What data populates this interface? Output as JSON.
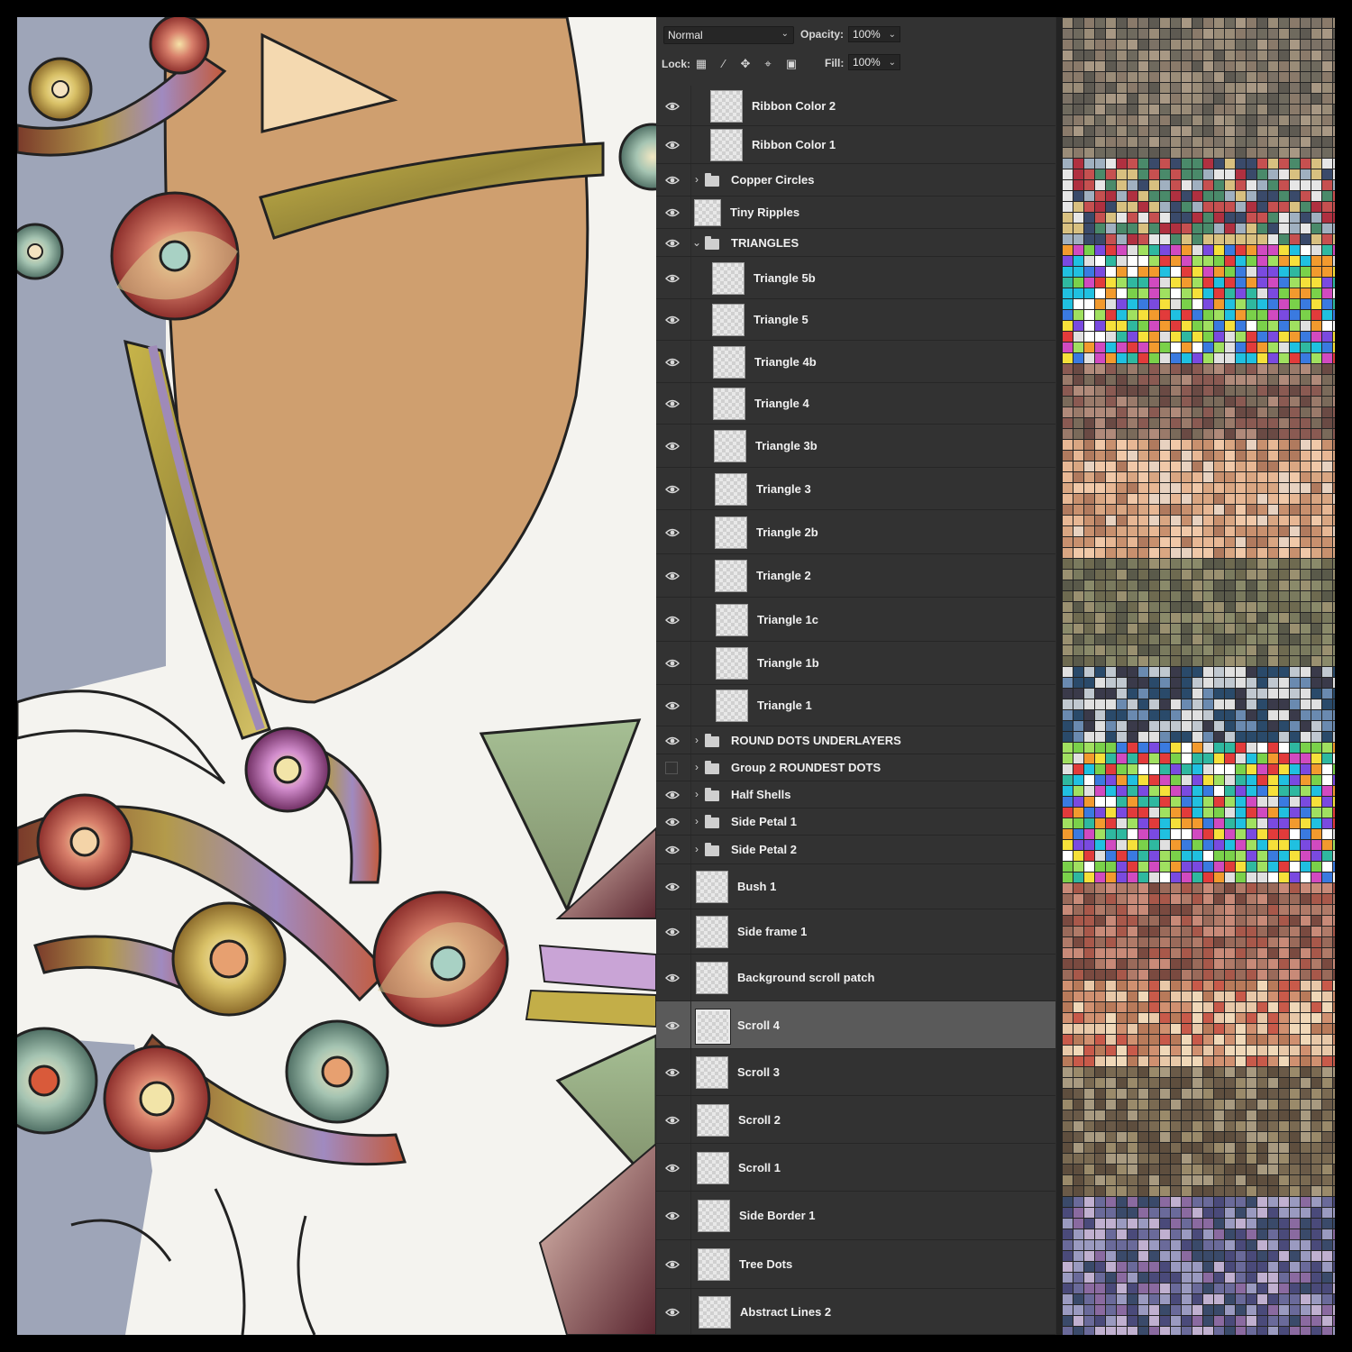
{
  "layers_panel": {
    "blend_mode": "Normal",
    "opacity_label": "Opacity:",
    "opacity_value": "100%",
    "lock_label": "Lock:",
    "fill_label": "Fill:",
    "fill_value": "100%",
    "layers": [
      {
        "name": "Ribbon Color 2",
        "type": "layer",
        "visible": true
      },
      {
        "name": "Ribbon Color 1",
        "type": "layer",
        "visible": true
      },
      {
        "name": "Copper Circles",
        "type": "group",
        "expanded": false,
        "visible": true
      },
      {
        "name": "Tiny Ripples",
        "type": "layer",
        "visible": true
      },
      {
        "name": "TRIANGLES",
        "type": "group",
        "expanded": true,
        "visible": true
      },
      {
        "name": "Triangle 5b",
        "type": "layer",
        "visible": true
      },
      {
        "name": "Triangle 5",
        "type": "layer",
        "visible": true
      },
      {
        "name": "Triangle 4b",
        "type": "layer",
        "visible": true
      },
      {
        "name": "Triangle 4",
        "type": "layer",
        "visible": true
      },
      {
        "name": "Triangle 3b",
        "type": "layer",
        "visible": true
      },
      {
        "name": "Triangle 3",
        "type": "layer",
        "visible": true
      },
      {
        "name": "Triangle 2b",
        "type": "layer",
        "visible": true
      },
      {
        "name": "Triangle 2",
        "type": "layer",
        "visible": true
      },
      {
        "name": "Triangle 1c",
        "type": "layer",
        "visible": true
      },
      {
        "name": "Triangle 1b",
        "type": "layer",
        "visible": true
      },
      {
        "name": "Triangle 1",
        "type": "layer",
        "visible": true
      },
      {
        "name": "ROUND DOTS UNDERLAYERS",
        "type": "group",
        "expanded": false,
        "visible": true
      },
      {
        "name": "Group 2 ROUNDEST DOTS",
        "type": "group",
        "expanded": false,
        "visible": false
      },
      {
        "name": "Half Shells",
        "type": "group",
        "expanded": false,
        "visible": true
      },
      {
        "name": "Side Petal 1",
        "type": "group",
        "expanded": false,
        "visible": true
      },
      {
        "name": "Side Petal 2",
        "type": "group",
        "expanded": false,
        "visible": true
      },
      {
        "name": "Bush 1",
        "type": "layer",
        "visible": true
      },
      {
        "name": "Side frame 1",
        "type": "layer",
        "visible": true
      },
      {
        "name": "Background scroll patch",
        "type": "layer",
        "visible": true
      },
      {
        "name": "Scroll 4",
        "type": "layer",
        "visible": true,
        "selected": true
      },
      {
        "name": "Scroll 3",
        "type": "layer",
        "visible": true
      },
      {
        "name": "Scroll 2",
        "type": "layer",
        "visible": true
      },
      {
        "name": "Scroll 1",
        "type": "layer",
        "visible": true
      },
      {
        "name": "Side Border 1",
        "type": "layer",
        "visible": true
      },
      {
        "name": "Tree Dots",
        "type": "layer",
        "visible": true
      },
      {
        "name": "Abstract  Lines 2",
        "type": "layer",
        "visible": true
      }
    ]
  },
  "icons": {
    "visibility": "eye-icon",
    "group": "folder-icon",
    "expand_collapsed": "chevron-right-icon",
    "expand_open": "chevron-down-icon",
    "lock_pixels": "checker-icon",
    "lock_paint": "brush-icon",
    "lock_position": "move-icon",
    "lock_artboard": "crop-icon",
    "lock_all": "padlock-icon"
  },
  "colors": {
    "panel_bg": "#323232",
    "panel_text": "#f0f0f0",
    "selected_row": "#5a5a5a",
    "canvas_tan": "#cf9f6f",
    "canvas_paper": "#f4f3ef",
    "canvas_gray_blue": "#9ea5b8"
  }
}
